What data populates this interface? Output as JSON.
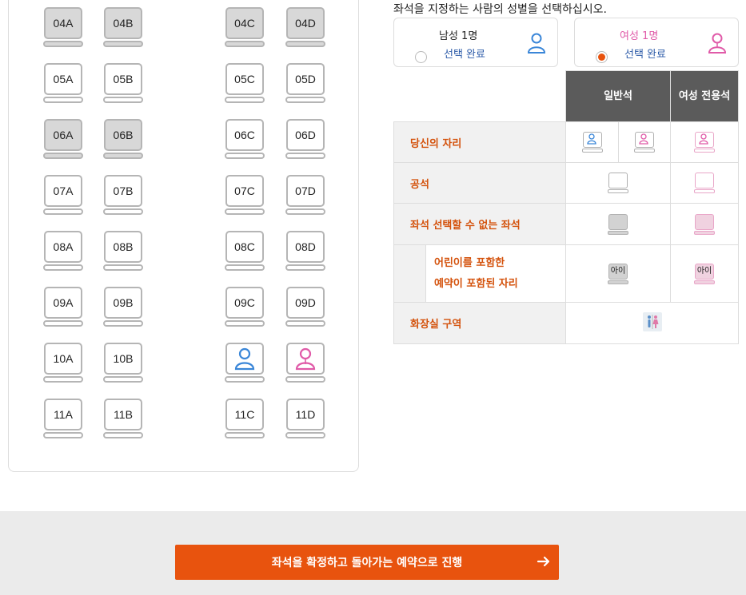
{
  "seats": [
    {
      "id": "04A",
      "taken": true
    },
    {
      "id": "04B",
      "taken": true
    },
    {
      "id": "04C",
      "taken": true
    },
    {
      "id": "04D",
      "taken": true
    },
    {
      "id": "05A",
      "taken": false
    },
    {
      "id": "05B",
      "taken": false
    },
    {
      "id": "05C",
      "taken": false
    },
    {
      "id": "05D",
      "taken": false
    },
    {
      "id": "06A",
      "taken": true
    },
    {
      "id": "06B",
      "taken": true
    },
    {
      "id": "06C",
      "taken": false
    },
    {
      "id": "06D",
      "taken": false
    },
    {
      "id": "07A",
      "taken": false
    },
    {
      "id": "07B",
      "taken": false
    },
    {
      "id": "07C",
      "taken": false
    },
    {
      "id": "07D",
      "taken": false
    },
    {
      "id": "08A",
      "taken": false
    },
    {
      "id": "08B",
      "taken": false
    },
    {
      "id": "08C",
      "taken": false
    },
    {
      "id": "08D",
      "taken": false
    },
    {
      "id": "09A",
      "taken": false
    },
    {
      "id": "09B",
      "taken": false
    },
    {
      "id": "09C",
      "taken": false
    },
    {
      "id": "09D",
      "taken": false
    },
    {
      "id": "10A",
      "taken": false
    },
    {
      "id": "10B",
      "taken": false
    },
    {
      "id": "10C",
      "taken": false,
      "icon": "male-person-icon"
    },
    {
      "id": "10D",
      "taken": false,
      "icon": "female-person-icon"
    },
    {
      "id": "11A",
      "taken": false
    },
    {
      "id": "11B",
      "taken": false
    },
    {
      "id": "11C",
      "taken": false
    },
    {
      "id": "11D",
      "taken": false
    }
  ],
  "instruction": "좌석을 지정하는 사람의 성별을 선택하십시오.",
  "gender_cards": {
    "male": {
      "label": "남성 1명",
      "status": "선택 완료",
      "selected": false,
      "icon": "male-person-icon"
    },
    "female": {
      "label": "여성 1명",
      "status": "선택 완료",
      "selected": true,
      "icon": "female-person-icon"
    }
  },
  "legend": {
    "col_general": "일반석",
    "col_women": "여성 전용석",
    "row_yours": "당신의 자리",
    "row_empty": "공석",
    "row_unavailable": "좌석 선택할 수 없는 좌석",
    "row_child": "어린이를 포함한 예약이 포함된 자리",
    "row_child_line1": "어린이를 포함한",
    "row_child_line2": "예약이 포함된 자리",
    "child_badge": "아이",
    "row_restroom": "화장실 구역"
  },
  "footer": {
    "confirm_label": "좌석을 확정하고 돌아가는 예약으로 진행",
    "arrow_icon": "arrow-right-icon"
  },
  "colors": {
    "accent": "#e8530e",
    "male": "#3a86d8",
    "female": "#e05aa8",
    "header": "#5b5b5b"
  }
}
